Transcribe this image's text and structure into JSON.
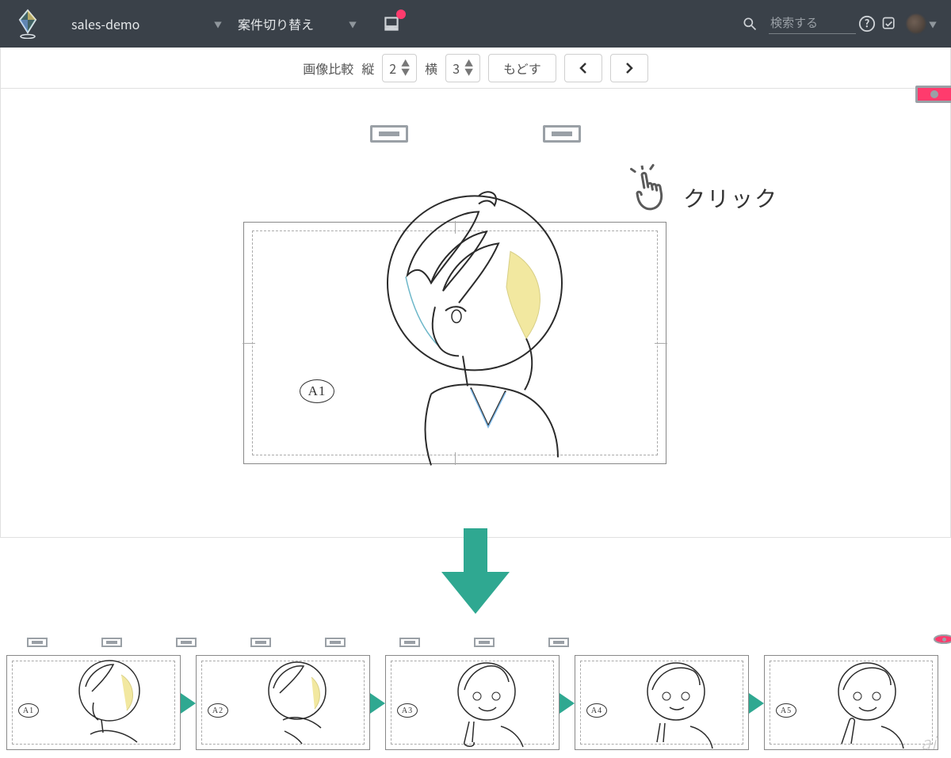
{
  "header": {
    "workspace": "sales-demo",
    "switcher_label": "案件切り替え",
    "search_placeholder": "検索する"
  },
  "toolbar": {
    "compare_label": "画像比較",
    "vertical_label": "縦",
    "vertical_value": "2",
    "horizontal_label": "横",
    "horizontal_value": "3",
    "undo_label": "もどす"
  },
  "annotation": {
    "click_label": "クリック"
  },
  "canvas": {
    "cel_label": "A1"
  },
  "thumbnails": [
    {
      "cel": "A1"
    },
    {
      "cel": "A2"
    },
    {
      "cel": "A3"
    },
    {
      "cel": "A4"
    },
    {
      "cel": "A5"
    }
  ],
  "watermark": "ai"
}
